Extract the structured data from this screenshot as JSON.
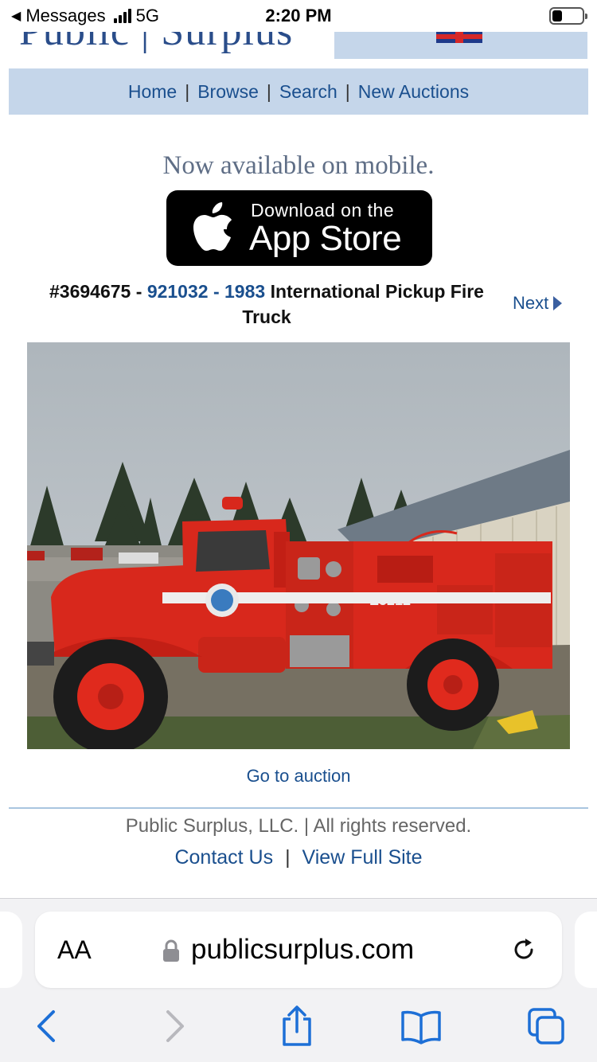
{
  "status_bar": {
    "back_app": "Messages",
    "network": "5G",
    "time": "2:20 PM"
  },
  "header": {
    "logo_text": "Public | Surplus",
    "nav": [
      "Home",
      "Browse",
      "Search",
      "New Auctions"
    ]
  },
  "promo": {
    "text": "Now available on mobile.",
    "app_store_top": "Download on the",
    "app_store_bottom": "App Store"
  },
  "listing": {
    "auction_number": "#3694675",
    "sep1": " - ",
    "asset_id": "921032",
    "sep2": " - ",
    "year": "1983",
    "name": " International Pickup Fire Truck",
    "next_label": "Next",
    "photo_alt": "1983 International red fire truck parked beside a metal building",
    "truck_unit_label": "E5212",
    "go_to_auction": "Go to auction"
  },
  "footer": {
    "copyright": "Public Surplus, LLC. | All rights reserved.",
    "contact": "Contact Us",
    "view_full_site": "View Full Site"
  },
  "safari": {
    "text_size_label": "AA",
    "url": "publicsurplus.com"
  },
  "colors": {
    "link": "#1a4f8e",
    "nav_bg": "#c5d6ea",
    "truck_red": "#d8281c"
  }
}
